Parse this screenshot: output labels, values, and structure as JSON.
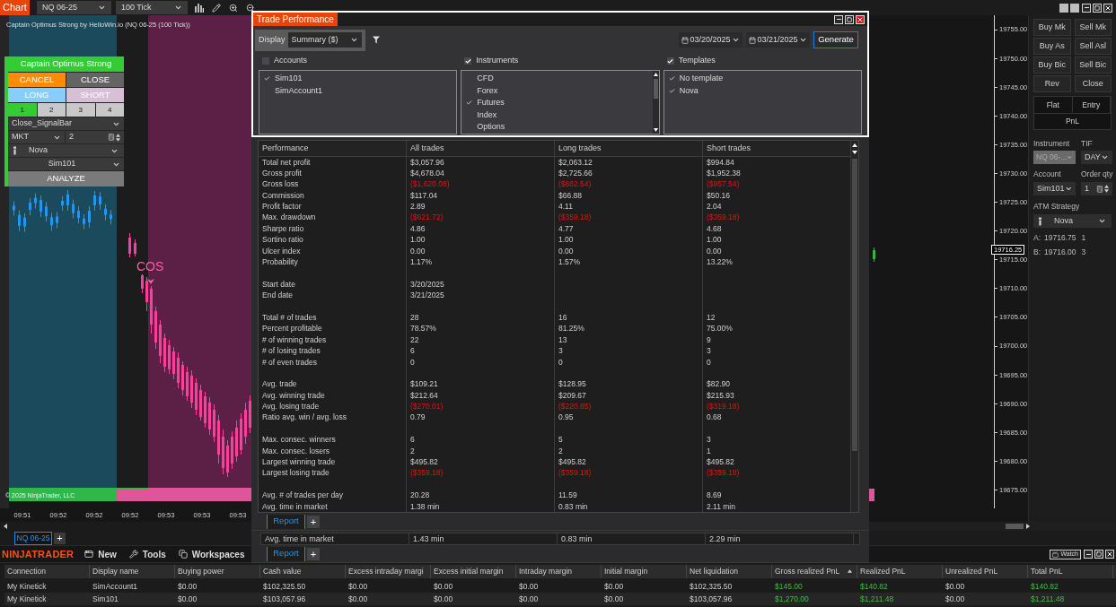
{
  "chart_window": {
    "tab": "Chart",
    "instrument": "NQ 06-25",
    "interval": "100 Tick",
    "chart_title": "Captain Optimus Strong by HelloWin.io (NQ 06-25 (100 Tick))",
    "strategy_panel": {
      "title": "Captain Optimus Strong",
      "actions": [
        {
          "label": "CANCEL",
          "color": "#ff8c00"
        },
        {
          "label": "CLOSE",
          "color": "#646464"
        },
        {
          "label": "LONG",
          "color": "#87cefa"
        },
        {
          "label": "SHORT",
          "color": "#d8bfd8"
        }
      ],
      "quantity_tabs": [
        {
          "label": "1",
          "selected": true
        },
        {
          "label": "2",
          "selected": false
        },
        {
          "label": "3",
          "selected": false
        },
        {
          "label": "4",
          "selected": false
        }
      ],
      "exit_mode": "Close_SignalBar",
      "order_type": "MKT",
      "quantity": "2",
      "atm_strategy": "Nova",
      "account": "Sim101",
      "analyze": "ANALYZE"
    },
    "signal_label": "COS",
    "copyright": "© 2025 NinjaTrader, LLC",
    "price_axis": [
      "19755.00",
      "19750.00",
      "19745.00",
      "19740.00",
      "19735.00",
      "19730.00",
      "19725.00",
      "19720.00",
      "19715.00",
      "19710.00",
      "19705.00",
      "19700.00",
      "19695.00",
      "19690.00",
      "19685.00",
      "19680.00",
      "19675.00"
    ],
    "last_price": "19716.25",
    "time_axis": [
      "09:51",
      "09:52",
      "09:52",
      "09:52",
      "09:53",
      "09:53",
      "09:53"
    ],
    "tabs": [
      {
        "label": "NQ 06-25",
        "selected": true
      }
    ],
    "add_tab": "+"
  },
  "chart_trader": {
    "order_buttons": [
      "Buy Mk",
      "Sell Mk",
      "Buy As",
      "Sell Asl",
      "Buy Bic",
      "Sell Bic",
      "Rev",
      "Close"
    ],
    "position_buttons": [
      "Flat",
      "Entry"
    ],
    "pnl_button": "PnL",
    "instrument": {
      "label": "Instrument",
      "value": "NQ 06-...",
      "disabled": true
    },
    "tif": {
      "label": "TIF",
      "value": "DAY"
    },
    "account": {
      "label": "Account",
      "value": "Sim101"
    },
    "order_qty": {
      "label": "Order qty",
      "value": "1"
    },
    "atm_strategy": {
      "label": "ATM Strategy",
      "value": "Nova"
    },
    "quotes": [
      {
        "label": "A:",
        "price": "19716.75",
        "size": "1"
      },
      {
        "label": "B:",
        "price": "19716.00",
        "size": "3"
      }
    ]
  },
  "trade_performance": {
    "title": "Trade Performance",
    "display": {
      "label": "Display",
      "value": "Summary ($)"
    },
    "from_date": "03/20/2025",
    "to_date": "03/21/2025",
    "generate": "Generate",
    "filters": [
      {
        "label": "Accounts",
        "checked": false,
        "items": [
          {
            "label": "Sim101",
            "checked": true
          },
          {
            "label": "SimAccount1",
            "checked": false
          }
        ]
      },
      {
        "label": "Instruments",
        "checked": true,
        "items": [
          {
            "label": "CFD",
            "checked": false
          },
          {
            "label": "Forex",
            "checked": false
          },
          {
            "label": "Futures",
            "checked": true
          },
          {
            "label": "Index",
            "checked": false
          },
          {
            "label": "Options",
            "checked": false
          }
        ]
      },
      {
        "label": "Templates",
        "checked": true,
        "items": [
          {
            "label": "No template",
            "checked": true
          },
          {
            "label": "Nova",
            "checked": true
          }
        ]
      }
    ],
    "table": {
      "columns": [
        "Performance",
        "All trades",
        "Long trades",
        "Short trades"
      ],
      "sections": [
        {
          "rows": [
            {
              "label": "Total net profit",
              "values": [
                "$3,057.96",
                "$2,063.12",
                "$994.84"
              ],
              "negative": false
            },
            {
              "label": "Gross profit",
              "values": [
                "$4,678.04",
                "$2,725.66",
                "$1,952.38"
              ],
              "negative": false
            },
            {
              "label": "Gross loss",
              "values": [
                "($1,620.08)",
                "($662.54)",
                "($957.54)"
              ],
              "negative": true
            },
            {
              "label": "Commission",
              "values": [
                "$117.04",
                "$66.88",
                "$50.16"
              ],
              "negative": false
            },
            {
              "label": "Profit factor",
              "values": [
                "2.89",
                "4.11",
                "2.04"
              ],
              "negative": false
            },
            {
              "label": "Max. drawdown",
              "values": [
                "($621.72)",
                "($359.18)",
                "($359.18)"
              ],
              "negative": true
            },
            {
              "label": "Sharpe ratio",
              "values": [
                "4.86",
                "4.77",
                "4.68"
              ],
              "negative": false
            },
            {
              "label": "Sortino ratio",
              "values": [
                "1.00",
                "1.00",
                "1.00"
              ],
              "negative": false
            },
            {
              "label": "Ulcer index",
              "values": [
                "0.00",
                "0.00",
                "0.00"
              ],
              "negative": false
            },
            {
              "label": "Probability",
              "values": [
                "1.17%",
                "1.57%",
                "13.22%"
              ],
              "negative": false
            }
          ]
        },
        {
          "rows": [
            {
              "label": "Start date",
              "values": [
                "3/20/2025"
              ],
              "negative": false
            },
            {
              "label": "End date",
              "values": [
                "3/21/2025"
              ],
              "negative": false
            }
          ]
        },
        {
          "rows": [
            {
              "label": "Total # of trades",
              "values": [
                "28",
                "16",
                "12"
              ],
              "negative": false
            },
            {
              "label": "Percent profitable",
              "values": [
                "78.57%",
                "81.25%",
                "75.00%"
              ],
              "negative": false
            },
            {
              "label": "# of winning trades",
              "values": [
                "22",
                "13",
                "9"
              ],
              "negative": false
            },
            {
              "label": "# of losing trades",
              "values": [
                "6",
                "3",
                "3"
              ],
              "negative": false
            },
            {
              "label": "# of even trades",
              "values": [
                "0",
                "0",
                "0"
              ],
              "negative": false
            }
          ]
        },
        {
          "rows": [
            {
              "label": "Avg. trade",
              "values": [
                "$109.21",
                "$128.95",
                "$82.90"
              ],
              "negative": false
            },
            {
              "label": "Avg. winning trade",
              "values": [
                "$212.64",
                "$209.67",
                "$215.93"
              ],
              "negative": false
            },
            {
              "label": "Avg. losing trade",
              "values": [
                "($270.01)",
                "($220.85)",
                "($319.18)"
              ],
              "negative": true
            },
            {
              "label": "Ratio avg. win / avg. loss",
              "values": [
                "0.79",
                "0.95",
                "0.68"
              ],
              "negative": false
            }
          ]
        },
        {
          "rows": [
            {
              "label": "Max. consec. winners",
              "values": [
                "6",
                "5",
                "3"
              ],
              "negative": false
            },
            {
              "label": "Max. consec. losers",
              "values": [
                "2",
                "2",
                "1"
              ],
              "negative": false
            },
            {
              "label": "Largest winning trade",
              "values": [
                "$495.82",
                "$495.82",
                "$495.82"
              ],
              "negative": false
            },
            {
              "label": "Largest losing trade",
              "values": [
                "($359.18)",
                "($359.18)",
                "($359.18)"
              ],
              "negative": true
            }
          ]
        },
        {
          "rows": [
            {
              "label": "Avg. # of trades per day",
              "values": [
                "20.28",
                "11.59",
                "8.69"
              ],
              "negative": false
            },
            {
              "label": "Avg. time in market",
              "values": [
                "1.38 min",
                "0.83 min",
                "2.11 min"
              ],
              "negative": false
            }
          ]
        }
      ]
    },
    "tabs": [
      {
        "label": "Report",
        "selected": true
      }
    ],
    "add_tab": "+"
  },
  "background_window": {
    "row": {
      "label": "Avg. time in market",
      "values": [
        "1.43 min",
        "0.83 min",
        "2.29 min"
      ]
    },
    "tabs": [
      {
        "label": "Report",
        "selected": true
      }
    ],
    "add_tab": "+"
  },
  "control_center": {
    "logo": "NINJATRADER",
    "menu": [
      "New",
      "Tools",
      "Workspaces"
    ],
    "watch": "Watch"
  },
  "accounts_grid": {
    "columns": [
      {
        "label": "Connection",
        "sorted": false
      },
      {
        "label": "Display name",
        "sorted": false
      },
      {
        "label": "Buying power",
        "sorted": false
      },
      {
        "label": "Cash value",
        "sorted": false
      },
      {
        "label": "Excess intraday margi",
        "sorted": false
      },
      {
        "label": "Excess initial margin",
        "sorted": false
      },
      {
        "label": "Intraday margin",
        "sorted": false
      },
      {
        "label": "Initial margin",
        "sorted": false
      },
      {
        "label": "Net liquidation",
        "sorted": false
      },
      {
        "label": "Gross realized PnL",
        "sorted": true
      },
      {
        "label": "Realized PnL",
        "sorted": false
      },
      {
        "label": "Unrealized PnL",
        "sorted": false
      },
      {
        "label": "Total PnL",
        "sorted": false
      }
    ],
    "rows": [
      {
        "cells": [
          {
            "text": "My Kinetick",
            "gain": false
          },
          {
            "text": "SimAccount1",
            "gain": false
          },
          {
            "text": "$0.00",
            "gain": false
          },
          {
            "text": "$102,325.50",
            "gain": false
          },
          {
            "text": "$0.00",
            "gain": false
          },
          {
            "text": "$0.00",
            "gain": false
          },
          {
            "text": "$0.00",
            "gain": false
          },
          {
            "text": "$0.00",
            "gain": false
          },
          {
            "text": "$102,325.50",
            "gain": false
          },
          {
            "text": "$145.00",
            "gain": true
          },
          {
            "text": "$140.82",
            "gain": true
          },
          {
            "text": "$0.00",
            "gain": false
          },
          {
            "text": "$140.82",
            "gain": true
          }
        ]
      },
      {
        "cells": [
          {
            "text": "My Kinetick",
            "gain": false
          },
          {
            "text": "Sim101",
            "gain": false
          },
          {
            "text": "$0.00",
            "gain": false
          },
          {
            "text": "$103,057.96",
            "gain": false
          },
          {
            "text": "$0.00",
            "gain": false
          },
          {
            "text": "$0.00",
            "gain": false
          },
          {
            "text": "$0.00",
            "gain": false
          },
          {
            "text": "$0.00",
            "gain": false
          },
          {
            "text": "$103,057.96",
            "gain": false
          },
          {
            "text": "$1,270.00",
            "gain": true
          },
          {
            "text": "$1,211.48",
            "gain": true
          },
          {
            "text": "$0.00",
            "gain": false
          },
          {
            "text": "$1,211.48",
            "gain": true
          }
        ]
      }
    ]
  }
}
